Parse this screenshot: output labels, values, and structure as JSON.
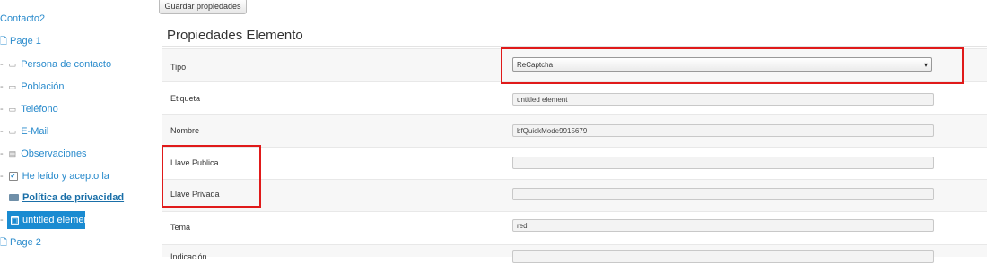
{
  "tree": {
    "form_name": "Contacto2",
    "page1": "Page 1",
    "items": [
      {
        "label": "Persona de contacto",
        "icon": "text-field-icon"
      },
      {
        "label": "Población",
        "icon": "text-field-icon"
      },
      {
        "label": "Teléfono",
        "icon": "text-field-icon"
      },
      {
        "label": "E-Mail",
        "icon": "text-field-icon"
      },
      {
        "label": "Observaciones",
        "icon": "textarea-icon"
      },
      {
        "label": "He leído y acepto la",
        "icon": "checkbox-icon"
      }
    ],
    "privacy": "Política de privacidad",
    "selected": "untitled element",
    "page2": "Page 2"
  },
  "toolbar": {
    "save_label": "Guardar propiedades"
  },
  "panel": {
    "title": "Propiedades Elemento",
    "tipo_label": "Tipo",
    "tipo_value": "ReCaptcha",
    "etiqueta_label": "Etiqueta",
    "etiqueta_value": "untitled element",
    "nombre_label": "Nombre",
    "nombre_value": "bfQuickMode9915679",
    "publica_label": "Llave Publica",
    "publica_value": "",
    "privada_label": "Llave Privada",
    "privada_value": "",
    "tema_label": "Tema",
    "tema_value": "red",
    "indicacion_label": "Indicación"
  },
  "colors": {
    "link": "#2a8bcc",
    "selected": "#1a8bd1",
    "highlight": "#e01a1a"
  }
}
